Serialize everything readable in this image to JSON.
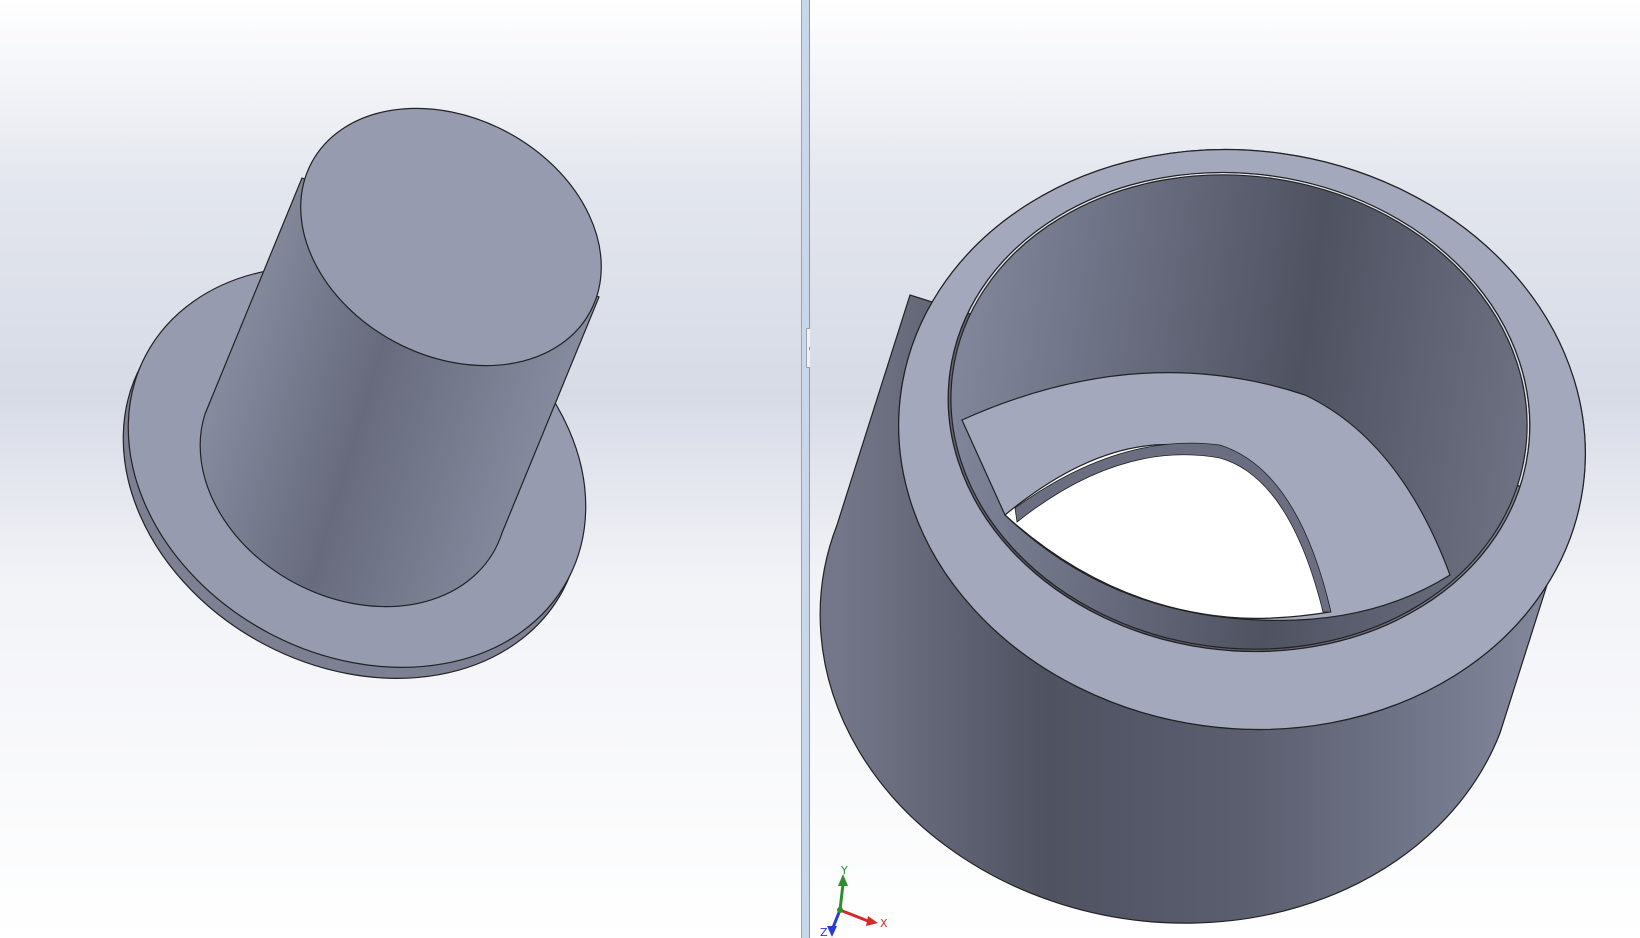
{
  "triad": {
    "x_label": "X",
    "y_label": "Y",
    "z_label": "Z",
    "x_color": "#d42a2a",
    "y_color": "#2f8f2f",
    "z_color": "#2a3ad4"
  },
  "colors": {
    "background_top": "#ffffff",
    "background_mid": "#d7dbe6",
    "model_face_light": "#a4a8bd",
    "model_face_dark": "#4f5261",
    "edge": "#222222"
  }
}
